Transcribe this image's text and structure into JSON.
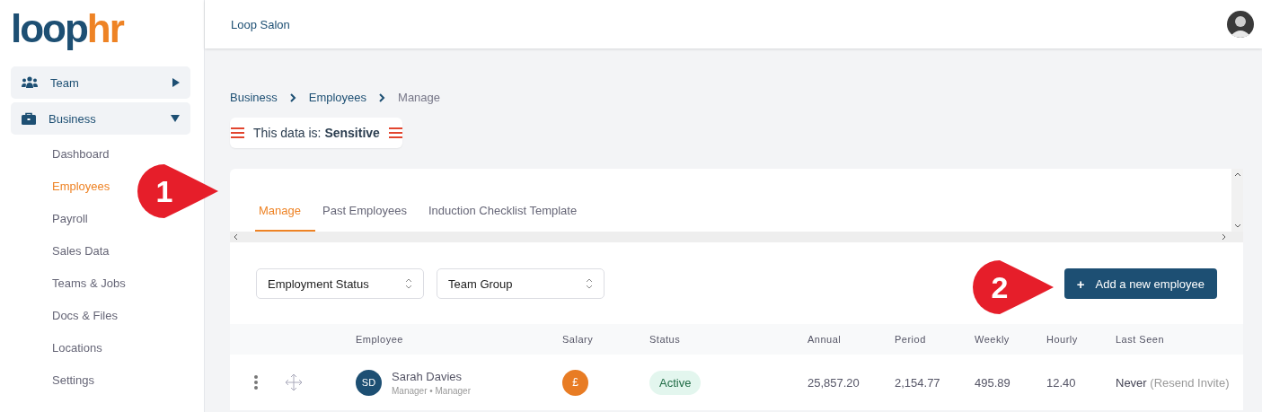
{
  "logo": {
    "part1": "loop",
    "part2": "hr"
  },
  "sidebar": {
    "items": [
      {
        "label": "Team",
        "kind": "team",
        "expanded": false
      },
      {
        "label": "Business",
        "kind": "business",
        "expanded": true,
        "children": [
          {
            "label": "Dashboard",
            "selected": false
          },
          {
            "label": "Employees",
            "selected": true
          },
          {
            "label": "Payroll",
            "selected": false
          },
          {
            "label": "Sales Data",
            "selected": false
          },
          {
            "label": "Teams & Jobs",
            "selected": false
          },
          {
            "label": "Docs & Files",
            "selected": false
          },
          {
            "label": "Locations",
            "selected": false
          },
          {
            "label": "Settings",
            "selected": false
          }
        ]
      }
    ]
  },
  "header": {
    "title": "Loop Salon"
  },
  "breadcrumb": [
    "Business",
    "Employees",
    "Manage"
  ],
  "sensitivity": {
    "prefix": "This data is: ",
    "level": "Sensitive"
  },
  "tabs": [
    {
      "label": "Manage",
      "selected": true
    },
    {
      "label": "Past Employees",
      "selected": false
    },
    {
      "label": "Induction Checklist Template",
      "selected": false
    }
  ],
  "filters": [
    {
      "value": "Employment Status"
    },
    {
      "value": "Team Group"
    }
  ],
  "add_button": {
    "label": "Add a new employee",
    "icon": "+"
  },
  "table": {
    "columns": [
      "Employee",
      "Salary",
      "Status",
      "Annual",
      "Period",
      "Weekly",
      "Hourly",
      "Last Seen"
    ],
    "rows": [
      {
        "initials": "SD",
        "name": "Sarah Davies",
        "role": "Manager • Manager",
        "salary_icon": "£",
        "status": "Active",
        "annual": "25,857.20",
        "period": "2,154.77",
        "weekly": "495.89",
        "hourly": "12.40",
        "last_seen": "Never",
        "invite": "(Resend Invite)"
      }
    ]
  },
  "callouts": [
    {
      "label": "1"
    },
    {
      "label": "2"
    }
  ]
}
